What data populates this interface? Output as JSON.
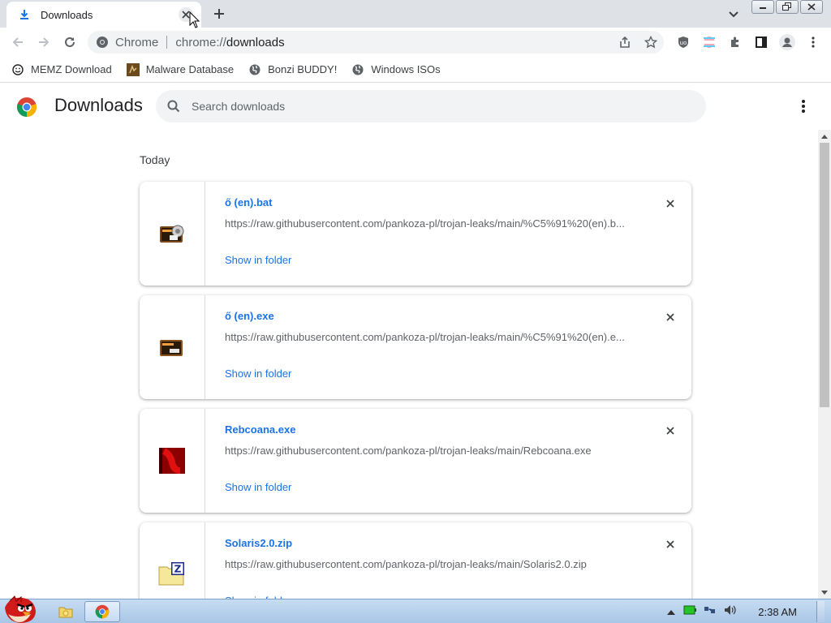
{
  "window": {
    "tab_title": "Downloads",
    "omnibox_chip": "Chrome",
    "url_scheme": "chrome://",
    "url_host": "downloads"
  },
  "bookmarks": [
    {
      "label": "MEMZ Download",
      "icon": "smiley-icon"
    },
    {
      "label": "Malware Database",
      "icon": "malware-db-icon"
    },
    {
      "label": "Bonzi BUDDY!",
      "icon": "globe-icon"
    },
    {
      "label": "Windows ISOs",
      "icon": "globe-icon"
    }
  ],
  "downloads_page": {
    "title": "Downloads",
    "search_placeholder": "Search downloads",
    "section": "Today",
    "show_in_folder": "Show in folder",
    "items": [
      {
        "name": "ő (en).bat",
        "url": "https://raw.githubusercontent.com/pankoza-pl/trojan-leaks/main/%C5%91%20(en).b...",
        "icon": "batch-file-icon"
      },
      {
        "name": "ő (en).exe",
        "url": "https://raw.githubusercontent.com/pankoza-pl/trojan-leaks/main/%C5%91%20(en).e...",
        "icon": "executable-file-icon"
      },
      {
        "name": "Rebcoana.exe",
        "url": "https://raw.githubusercontent.com/pankoza-pl/trojan-leaks/main/Rebcoana.exe",
        "icon": "red-app-icon"
      },
      {
        "name": "Solaris2.0.zip",
        "url": "https://raw.githubusercontent.com/pankoza-pl/trojan-leaks/main/Solaris2.0.zip",
        "icon": "zip-folder-icon"
      }
    ]
  },
  "taskbar": {
    "clock": "2:38 AM"
  },
  "colors": {
    "link_blue": "#1a73e8",
    "tab_strip": "#dee1e6",
    "taskbar": "#b8d1ec"
  }
}
